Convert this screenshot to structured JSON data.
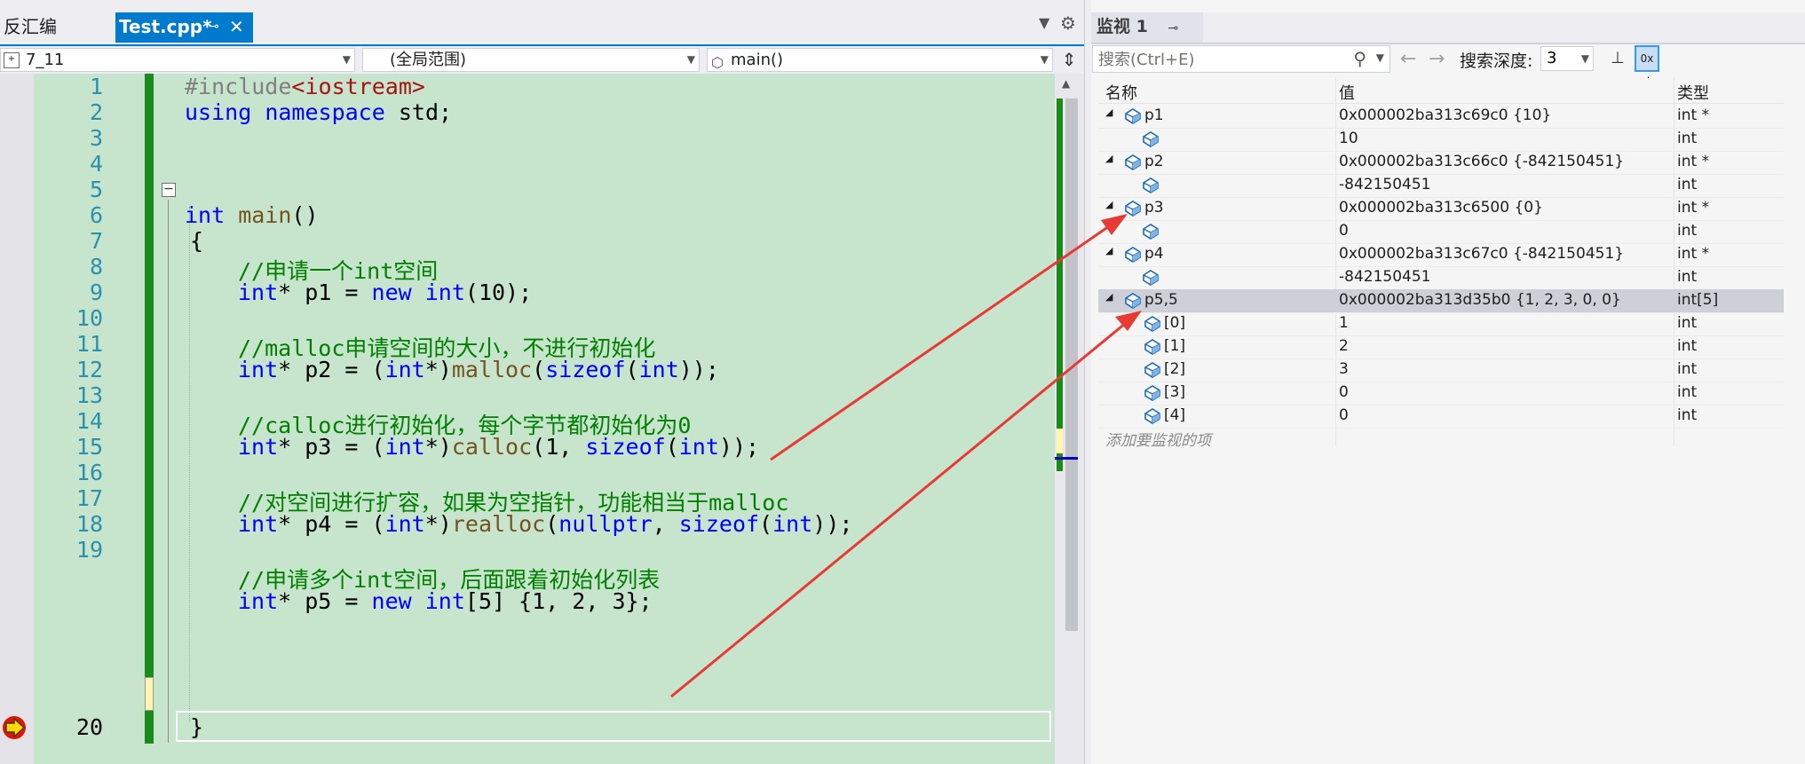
{
  "editor": {
    "tabs": [
      {
        "label": "反汇编"
      },
      {
        "label": "Test.cpp*",
        "pin": "⊸",
        "close": "✕"
      }
    ],
    "nav": {
      "project": "7_11",
      "scope": "(全局范围)",
      "function": "main()"
    },
    "line_numbers": [
      "1",
      "2",
      "3",
      "4",
      "5",
      "6",
      "7",
      "8",
      "9",
      "10",
      "11",
      "12",
      "13",
      "14",
      "15",
      "16",
      "17",
      "18",
      "19",
      "20"
    ],
    "code": {
      "l1_pp": "#include",
      "l1_inc": "<iostream>",
      "l2_kw1": "using",
      "l2_kw2": "namespace",
      "l2_rest": " std;",
      "l4_kw": "int",
      "l4_fn": " main",
      "l4_rest": "()",
      "l5": "{",
      "l6_cm": "//申请一个int空间",
      "l7_kw1": "int",
      "l7_a": "* p1 = ",
      "l7_kw2": "new",
      "l7_b": " ",
      "l7_kw3": "int",
      "l7_c": "(10);",
      "l9_cm": "//malloc申请空间的大小，不进行初始化",
      "l10_kw1": "int",
      "l10_a": "* p2 = (",
      "l10_kw2": "int",
      "l10_b": "*)",
      "l10_fn": "malloc",
      "l10_c": "(",
      "l10_kw3": "sizeof",
      "l10_d": "(",
      "l10_kw4": "int",
      "l10_e": "));",
      "l12_cm": "//calloc进行初始化，每个字节都初始化为0",
      "l13_kw1": "int",
      "l13_a": "* p3 = (",
      "l13_kw2": "int",
      "l13_b": "*)",
      "l13_fn": "calloc",
      "l13_c": "(1, ",
      "l13_kw3": "sizeof",
      "l13_d": "(",
      "l13_kw4": "int",
      "l13_e": "));",
      "l15_cm": "//对空间进行扩容，如果为空指针，功能相当于malloc",
      "l16_kw1": "int",
      "l16_a": "* p4 = (",
      "l16_kw2": "int",
      "l16_b": "*)",
      "l16_fn": "realloc",
      "l16_c": "(",
      "l16_kw3": "nullptr",
      "l16_d": ", ",
      "l16_kw4": "sizeof",
      "l16_e": "(",
      "l16_kw5": "int",
      "l16_f": "));",
      "l18_cm": "//申请多个int空间，后面跟着初始化列表",
      "l19_kw1": "int",
      "l19_a": "* p5 = ",
      "l19_kw2": "new",
      "l19_b": " ",
      "l19_kw3": "int",
      "l19_c": "[5] {1, 2, 3};",
      "l20": "}"
    },
    "current_line": 20
  },
  "watch": {
    "title": "监视 1",
    "pin": "⊸",
    "close": "✕",
    "search_placeholder": "搜索(Ctrl+E)",
    "depth_label": "搜索深度:",
    "depth_value": "3",
    "hex_button": "0x ab",
    "columns": {
      "name": "名称",
      "value": "值",
      "type": "类型"
    },
    "rows": [
      {
        "name": "p1",
        "value": "0x000002ba313c69c0 {10}",
        "type": "int *",
        "level": 0,
        "expanded": true
      },
      {
        "name": "",
        "value": "10",
        "type": "int",
        "level": 1
      },
      {
        "name": "p2",
        "value": "0x000002ba313c66c0 {-842150451}",
        "type": "int *",
        "level": 0,
        "expanded": true
      },
      {
        "name": "",
        "value": "-842150451",
        "type": "int",
        "level": 1
      },
      {
        "name": "p3",
        "value": "0x000002ba313c6500 {0}",
        "type": "int *",
        "level": 0,
        "expanded": true
      },
      {
        "name": "",
        "value": "0",
        "type": "int",
        "level": 1
      },
      {
        "name": "p4",
        "value": "0x000002ba313c67c0 {-842150451}",
        "type": "int *",
        "level": 0,
        "expanded": true
      },
      {
        "name": "",
        "value": "-842150451",
        "type": "int",
        "level": 1
      },
      {
        "name": "p5,5",
        "value": "0x000002ba313d35b0 {1, 2, 3, 0, 0}",
        "type": "int[5]",
        "level": 0,
        "expanded": true,
        "selected": true
      },
      {
        "name": "[0]",
        "value": "1",
        "type": "int",
        "level": 2
      },
      {
        "name": "[1]",
        "value": "2",
        "type": "int",
        "level": 2
      },
      {
        "name": "[2]",
        "value": "3",
        "type": "int",
        "level": 2
      },
      {
        "name": "[3]",
        "value": "0",
        "type": "int",
        "level": 2
      },
      {
        "name": "[4]",
        "value": "0",
        "type": "int",
        "level": 2
      }
    ],
    "add_watch": "添加要监视的项"
  },
  "colors": {
    "accent": "#007acc",
    "code_bg": "#c7e4cc",
    "keyword": "#0000ff",
    "comment": "#008000",
    "annotation_arrow": "#e83a35"
  }
}
